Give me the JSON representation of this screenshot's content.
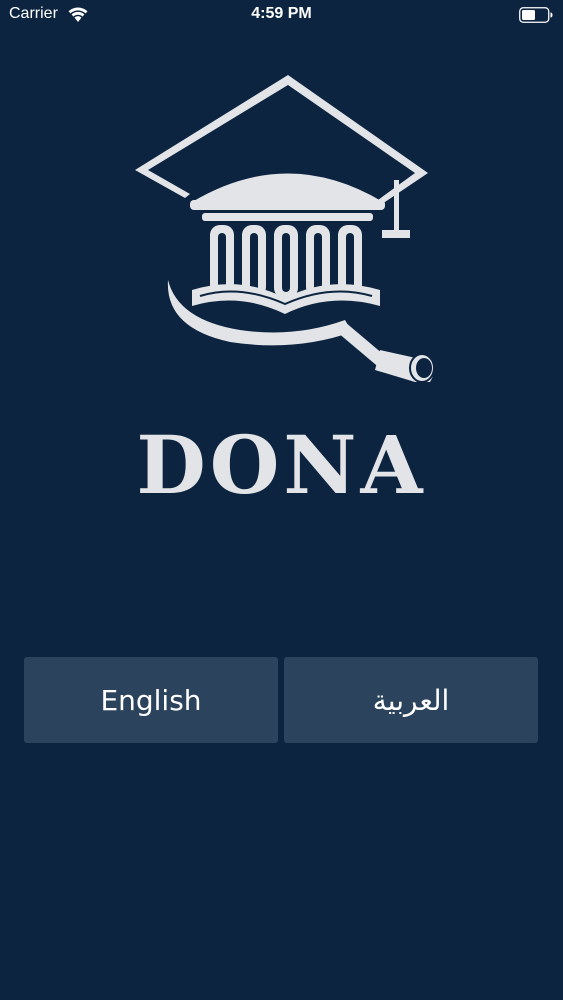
{
  "status_bar": {
    "carrier": "Carrier",
    "time": "4:59 PM"
  },
  "brand": {
    "name": "DONA"
  },
  "language": {
    "english_label": "English",
    "arabic_label": "العربية"
  },
  "colors": {
    "background": "#0c2440",
    "button": "#2b435c",
    "logo": "#e2e4e8"
  }
}
